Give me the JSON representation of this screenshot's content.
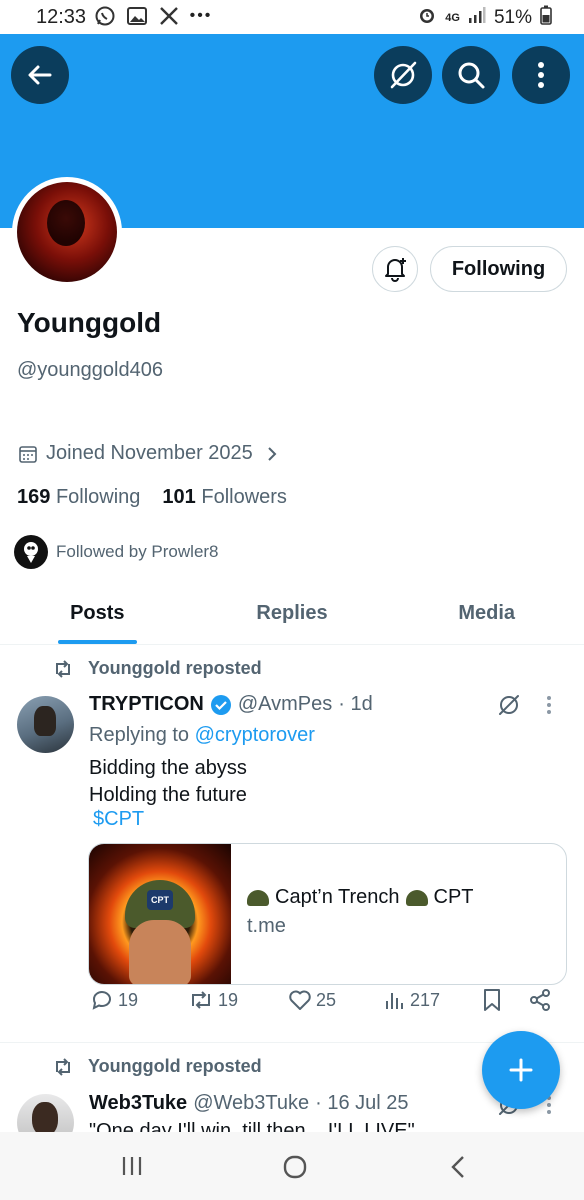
{
  "status_bar": {
    "time": "12:33",
    "network": "4G",
    "battery": "51%",
    "left_icons": [
      "whatsapp-icon",
      "gallery-icon",
      "x-icon",
      "more-dots"
    ],
    "right_icons": [
      "alarm-icon",
      "signal-icon",
      "battery-icon"
    ]
  },
  "profile": {
    "display_name": "Younggold",
    "handle": "@younggold406",
    "joined": "Joined November 2025",
    "following_count": "169",
    "following_label": "Following",
    "followers_count": "101",
    "followers_label": "Followers",
    "followed_by": "Followed by Prowler8",
    "follow_button": "Following"
  },
  "tabs": [
    {
      "label": "Posts",
      "active": true
    },
    {
      "label": "Replies",
      "active": false
    },
    {
      "label": "Media",
      "active": false
    }
  ],
  "posts": [
    {
      "repost_label": "Younggold reposted",
      "author_name": "TRYPTICON",
      "author_handle": "@AvmPes",
      "time": "· 1d",
      "replying_to_prefix": "Replying to",
      "replying_to": "@cryptorover",
      "text_line1": "Bidding the abyss",
      "text_line2": "Holding the future",
      "cashtag": "$CPT",
      "card_title_a": "Capt’n Trench",
      "card_title_b": "CPT",
      "card_domain": "t.me",
      "card_badge": "CPT",
      "replies": "19",
      "reposts": "19",
      "likes": "25",
      "views": "217"
    },
    {
      "repost_label": "Younggold reposted",
      "author_name": "Web3Tuke",
      "author_handle": "@Web3Tuke",
      "time": "· 16 Jul 25",
      "text": "\"One day I'll win, till then... I'LL LIVE\""
    }
  ],
  "colors": {
    "accent": "#1d9bf0",
    "banner": "#1d9bf0",
    "muted_text": "#536471",
    "primary_text": "#0f1419"
  }
}
